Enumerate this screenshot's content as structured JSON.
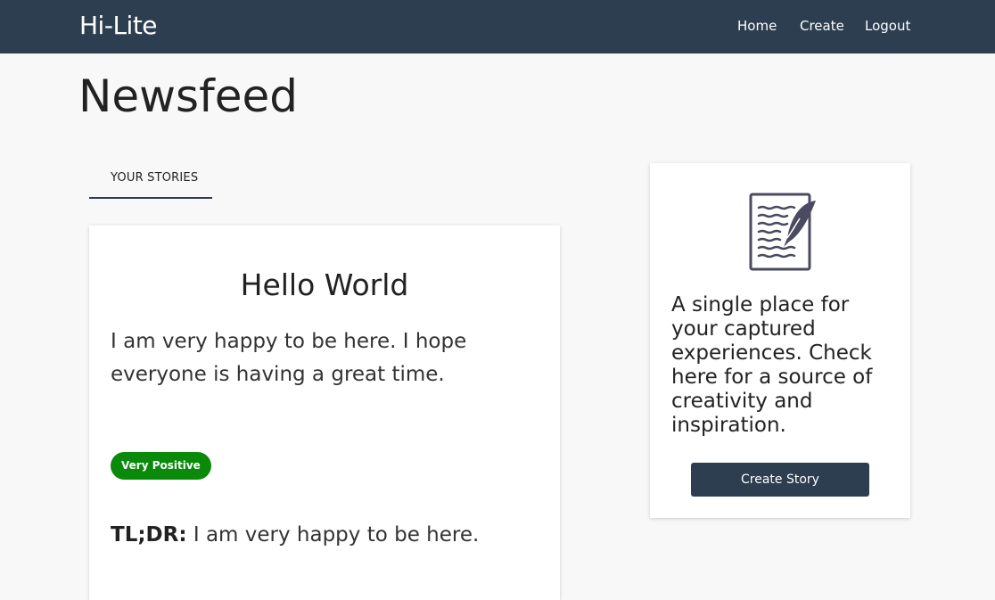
{
  "navbar": {
    "brand": "Hi-Lite",
    "links": [
      "Home",
      "Create",
      "Logout"
    ]
  },
  "page": {
    "title": "Newsfeed"
  },
  "tabs": [
    {
      "label": "YOUR STORIES",
      "active": true
    }
  ],
  "story": {
    "title": "Hello World",
    "body": "I am very happy to be here. I hope everyone is having a great time.",
    "sentiment": "Very Positive",
    "sentiment_color": "#0a8a0a",
    "tldr_label": "TL;DR:",
    "tldr_text": "I am very happy to be here."
  },
  "sidebar": {
    "icon": "document-quill-icon",
    "description": "A single place for your captured experiences. Check here for a source of creativity and inspiration.",
    "button_label": "Create Story"
  },
  "colors": {
    "navbar": "#2d3e50",
    "background": "#f8f8f8",
    "accent": "#2d3e50"
  }
}
